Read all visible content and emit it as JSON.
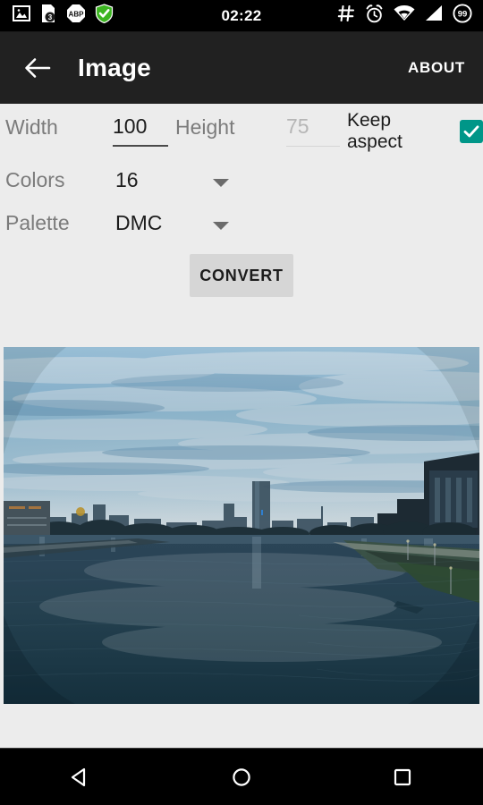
{
  "status_bar": {
    "clock": "02:22",
    "left_icons": [
      {
        "name": "image-notification-icon",
        "label": "image"
      },
      {
        "name": "downloads-badge-icon",
        "label": "3"
      },
      {
        "name": "adblock-plus-icon",
        "label": "ABP"
      },
      {
        "name": "security-shield-icon",
        "label": "shield"
      }
    ],
    "right_icons": [
      {
        "name": "hash-icon",
        "label": "#"
      },
      {
        "name": "alarm-clock-icon",
        "label": "alarm"
      },
      {
        "name": "wifi-icon",
        "label": "wifi"
      },
      {
        "name": "cell-signal-icon",
        "label": "signal"
      },
      {
        "name": "battery-percent-icon",
        "label": "99"
      }
    ]
  },
  "app_bar": {
    "back_label": "back",
    "title": "Image",
    "about_label": "ABOUT"
  },
  "form": {
    "width": {
      "label": "Width",
      "value": "100"
    },
    "height": {
      "label": "Height",
      "value": "75"
    },
    "keep_aspect": {
      "label": "Keep aspect",
      "checked": true,
      "check_glyph": "✓"
    },
    "colors": {
      "label": "Colors",
      "value": "16"
    },
    "palette": {
      "label": "Palette",
      "value": "DMC"
    },
    "convert_label": "CONVERT"
  },
  "photo": {
    "description": "City river at dusk with overcast clouds and skyline"
  },
  "nav_bar": {
    "back_label": "back",
    "home_label": "home",
    "recents_label": "recents"
  },
  "colors": {
    "accent_teal": "#009688",
    "app_bar_bg": "#212121",
    "status_bar_bg": "#000000",
    "page_bg": "#ececec",
    "button_bg": "#d6d6d6",
    "text_primary": "#1c1c1c",
    "text_secondary": "#7b7b7b",
    "text_hint": "#b6b6b6"
  }
}
